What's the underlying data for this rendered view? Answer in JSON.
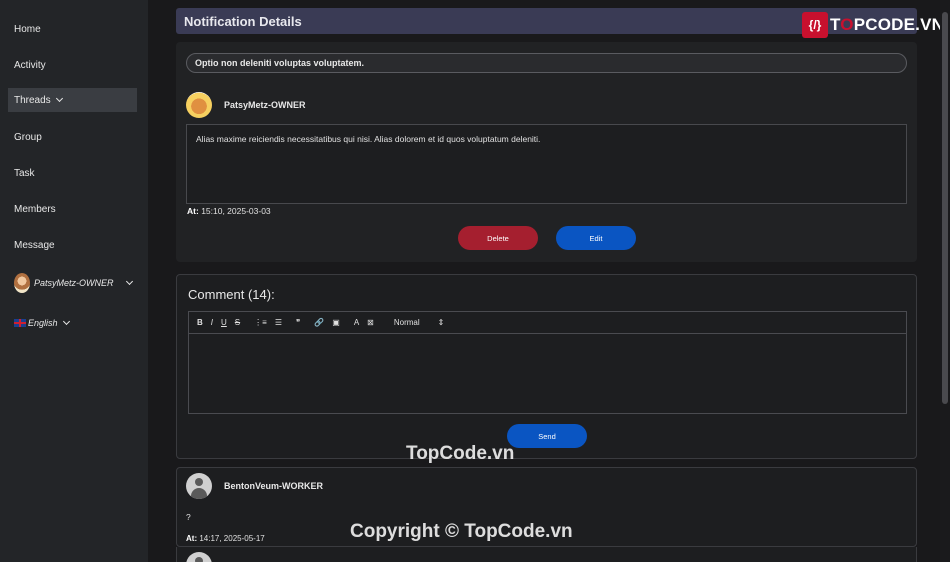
{
  "sidebar": {
    "items": [
      {
        "label": "Home"
      },
      {
        "label": "Activity"
      },
      {
        "label": "Threads"
      },
      {
        "label": "Group"
      },
      {
        "label": "Task"
      },
      {
        "label": "Members"
      },
      {
        "label": "Message"
      }
    ],
    "user": "PatsyMetz-OWNER",
    "language": "English"
  },
  "header": {
    "title": "Notification Details"
  },
  "logo": {
    "badge": "{/}",
    "text_a": "T",
    "text_o": "O",
    "text_b": "PCODE.VN"
  },
  "notification": {
    "subject": "Optio non deleniti voluptas voluptatem.",
    "author": "PatsyMetz-OWNER",
    "body": "Alias maxime reiciendis necessitatibus qui nisi. Alias dolorem et id quos voluptatum deleniti.",
    "at_label": "At:",
    "at_value": "15:10, 2025-03-03",
    "delete_label": "Delete",
    "edit_label": "Edit"
  },
  "comments": {
    "title": "Comment (14):",
    "toolbar": {
      "bold": "B",
      "italic": "I",
      "underline": "U",
      "strike": "S",
      "ordered": "⋮≡",
      "bullet": "☰",
      "quote": "❞",
      "link": "🔗",
      "image": "▣",
      "color": "A",
      "clear": "⊠",
      "format": "Normal",
      "format_arrow": "⇕"
    },
    "send_label": "Send",
    "items": [
      {
        "author": "BentonVeum-WORKER",
        "text": "?",
        "at_label": "At:",
        "at_value": "14:17, 2025-05-17"
      }
    ]
  },
  "watermarks": [
    "TopCode.vn",
    "Copyright © TopCode.vn"
  ]
}
